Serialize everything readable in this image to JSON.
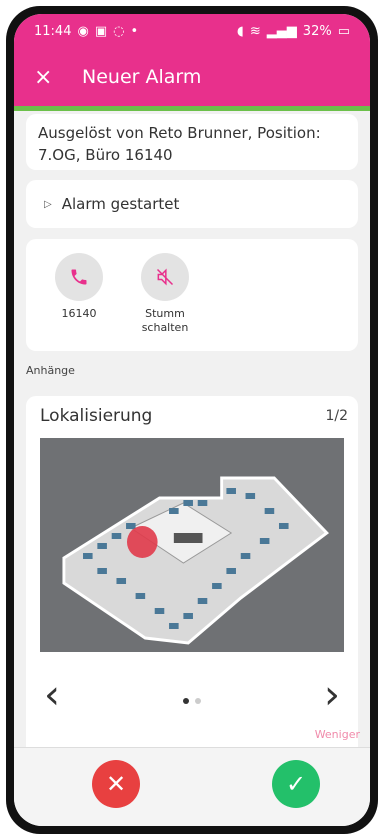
{
  "status": {
    "time": "11:44",
    "battery": "32%"
  },
  "appbar": {
    "close_icon": "×",
    "title": "Neuer Alarm"
  },
  "info": {
    "text": "Ausgelöst von Reto Brunner, Position: 7.OG, Büro 16140"
  },
  "alarm": {
    "label": "Alarm gestartet"
  },
  "actions": [
    {
      "icon": "phone-icon",
      "label": "16140"
    },
    {
      "icon": "mute-icon",
      "label": "Stumm schalten"
    }
  ],
  "attachments": {
    "section_label": "Anhänge",
    "title": "Lokalisierung",
    "page": "1/2",
    "prev_symbol": "‹",
    "next_symbol": "›"
  },
  "footer": {
    "less_label": "Weniger"
  },
  "colors": {
    "accent": "#e8308c",
    "success": "#23c06a",
    "danger": "#e84040",
    "line": "#6cc04a"
  }
}
